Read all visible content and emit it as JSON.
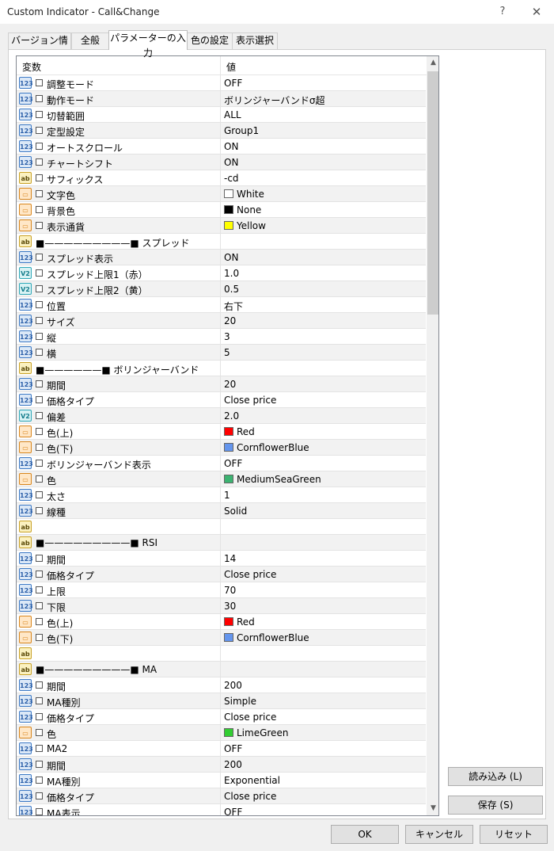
{
  "window": {
    "title": "Custom Indicator - Call&Change",
    "help": "?",
    "close": "✕"
  },
  "tabs": [
    {
      "label": "バージョン情報"
    },
    {
      "label": "全般"
    },
    {
      "label": "パラメーターの入力",
      "active": true
    },
    {
      "label": "色の設定"
    },
    {
      "label": "表示選択"
    }
  ],
  "grid": {
    "header_name": "変数",
    "header_value": "値"
  },
  "icons": {
    "int": "123",
    "str": "ab",
    "dbl": "V2",
    "col": "color"
  },
  "rows": [
    {
      "icon": "int",
      "name": "調整モード",
      "value": "OFF"
    },
    {
      "icon": "int",
      "name": "動作モード",
      "value": "ボリンジャーバンドσ超"
    },
    {
      "icon": "int",
      "name": "切替範囲",
      "value": "ALL"
    },
    {
      "icon": "int",
      "name": "定型設定",
      "value": "Group1"
    },
    {
      "icon": "int",
      "name": "オートスクロール",
      "value": "ON"
    },
    {
      "icon": "int",
      "name": "チャートシフト",
      "value": "ON"
    },
    {
      "icon": "str",
      "name": "サフィックス",
      "value": "-cd"
    },
    {
      "icon": "col",
      "name": "文字色",
      "value": "White",
      "color": "#ffffff"
    },
    {
      "icon": "col",
      "name": "背景色",
      "value": "None",
      "color": "#000000"
    },
    {
      "icon": "col",
      "name": "表示通貨",
      "value": "Yellow",
      "color": "#ffff00"
    },
    {
      "icon": "str",
      "name": "■—————————■ スプレッド",
      "value": "",
      "nobox": true
    },
    {
      "icon": "int",
      "name": "スプレッド表示",
      "value": "ON"
    },
    {
      "icon": "dbl",
      "name": "スプレッド上限1（赤）",
      "value": "1.0"
    },
    {
      "icon": "dbl",
      "name": "スプレッド上限2（黄）",
      "value": "0.5"
    },
    {
      "icon": "int",
      "name": "位置",
      "value": "右下"
    },
    {
      "icon": "int",
      "name": "サイズ",
      "value": "20"
    },
    {
      "icon": "int",
      "name": "縦",
      "value": "3"
    },
    {
      "icon": "int",
      "name": "横",
      "value": "5"
    },
    {
      "icon": "str",
      "name": "■——————■ ボリンジャーバンド",
      "value": "",
      "nobox": true
    },
    {
      "icon": "int",
      "name": "期間",
      "value": "20"
    },
    {
      "icon": "int",
      "name": "価格タイプ",
      "value": "Close price"
    },
    {
      "icon": "dbl",
      "name": "偏差",
      "value": "2.0"
    },
    {
      "icon": "col",
      "name": "色(上)",
      "value": "Red",
      "color": "#ff0000"
    },
    {
      "icon": "col",
      "name": "色(下)",
      "value": "CornflowerBlue",
      "color": "#6495ed"
    },
    {
      "icon": "int",
      "name": "ボリンジャーバンド表示",
      "value": "OFF"
    },
    {
      "icon": "col",
      "name": "色",
      "value": "MediumSeaGreen",
      "color": "#3cb371"
    },
    {
      "icon": "int",
      "name": "太さ",
      "value": "1"
    },
    {
      "icon": "int",
      "name": "線種",
      "value": "Solid"
    },
    {
      "icon": "str",
      "name": "",
      "value": "",
      "nobox": true
    },
    {
      "icon": "str",
      "name": "■—————————■ RSI",
      "value": "",
      "nobox": true
    },
    {
      "icon": "int",
      "name": "期間",
      "value": "14"
    },
    {
      "icon": "int",
      "name": "価格タイプ",
      "value": "Close price"
    },
    {
      "icon": "int",
      "name": "上限",
      "value": "70"
    },
    {
      "icon": "int",
      "name": "下限",
      "value": "30"
    },
    {
      "icon": "col",
      "name": "色(上)",
      "value": "Red",
      "color": "#ff0000"
    },
    {
      "icon": "col",
      "name": "色(下)",
      "value": "CornflowerBlue",
      "color": "#6495ed"
    },
    {
      "icon": "str",
      "name": "",
      "value": "",
      "nobox": true
    },
    {
      "icon": "str",
      "name": "■—————————■ MA",
      "value": "",
      "nobox": true
    },
    {
      "icon": "int",
      "name": "期間",
      "value": "200"
    },
    {
      "icon": "int",
      "name": "MA種別",
      "value": "Simple"
    },
    {
      "icon": "int",
      "name": "価格タイプ",
      "value": "Close price"
    },
    {
      "icon": "col",
      "name": "色",
      "value": "LimeGreen",
      "color": "#32cd32"
    },
    {
      "icon": "int",
      "name": "MA2",
      "value": "OFF"
    },
    {
      "icon": "int",
      "name": "期間",
      "value": "200"
    },
    {
      "icon": "int",
      "name": "MA種別",
      "value": "Exponential"
    },
    {
      "icon": "int",
      "name": "価格タイプ",
      "value": "Close price"
    },
    {
      "icon": "int",
      "name": "MA表示",
      "value": "OFF"
    }
  ],
  "buttons": {
    "load": "読み込み (L)",
    "save": "保存 (S)",
    "ok": "OK",
    "cancel": "キャンセル",
    "reset": "リセット"
  }
}
